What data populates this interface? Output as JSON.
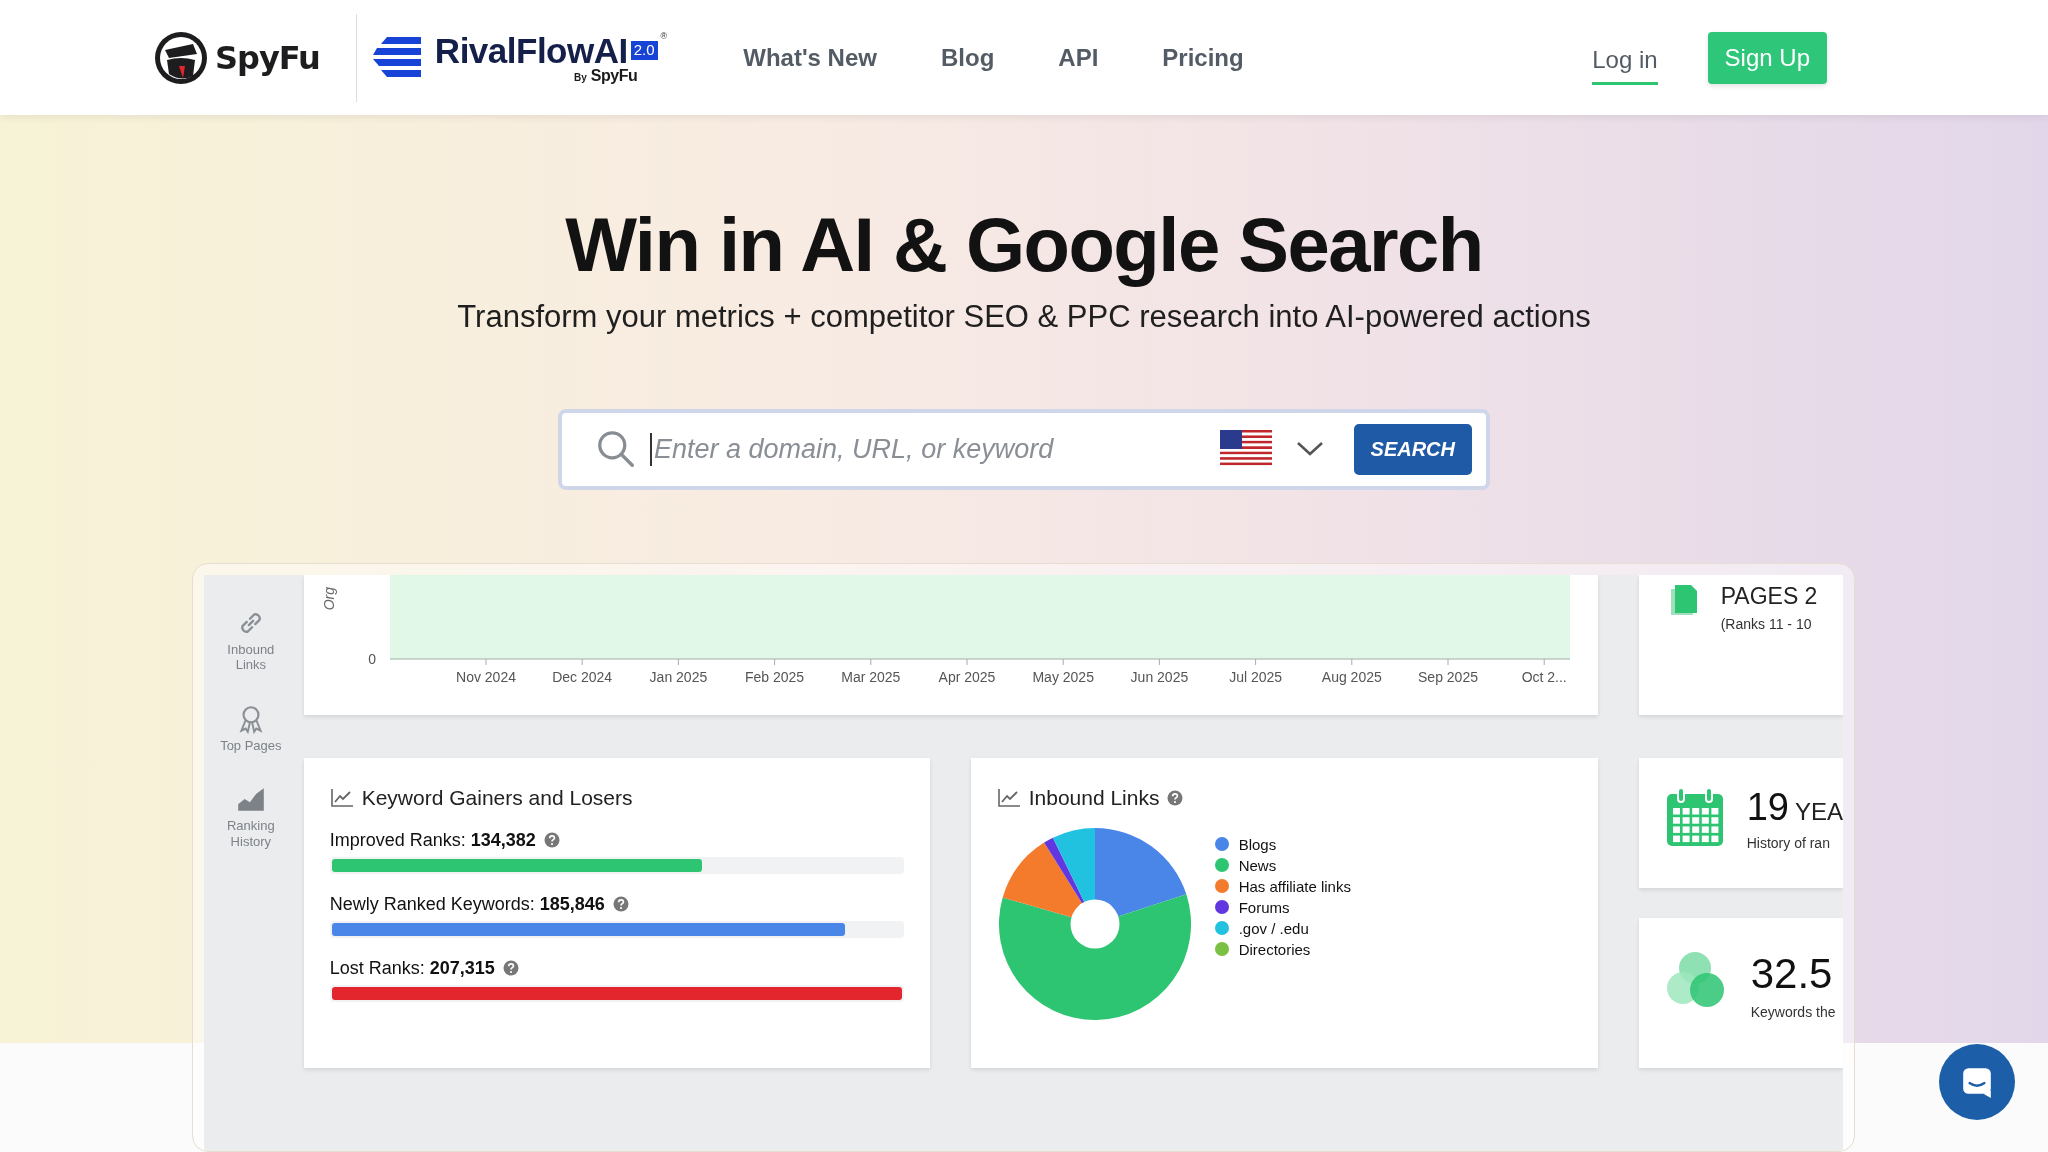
{
  "header": {
    "logo": "SpyFu",
    "product_logo": {
      "name": "RivalFlowAI",
      "version": "2.0",
      "mark": "®",
      "by": "By",
      "by_brand": "SpyFu"
    },
    "nav": [
      "What's New",
      "Blog",
      "API",
      "Pricing"
    ],
    "login": "Log in",
    "signup": "Sign Up"
  },
  "hero": {
    "title": "Win in AI & Google Search",
    "subtitle": "Transform your metrics + competitor SEO & PPC research into AI-powered actions",
    "search": {
      "placeholder": "Enter a domain, URL, or keyword",
      "button": "SEARCH"
    }
  },
  "dashboard": {
    "sidebar": [
      {
        "kind": "link",
        "label": "Inbound Links"
      },
      {
        "kind": "award",
        "label": "Top Pages"
      },
      {
        "kind": "area",
        "label": "Ranking History"
      }
    ],
    "traffic_chart": {
      "y_axis_label": "Org",
      "y_tick": "0",
      "x_labels": [
        "Nov 2024",
        "Dec 2024",
        "Jan 2025",
        "Feb 2025",
        "Mar 2025",
        "Apr 2025",
        "May 2025",
        "Jun 2025",
        "Jul 2025",
        "Aug 2025",
        "Sep 2025",
        "Oct 2..."
      ]
    },
    "gainers": {
      "title": "Keyword Gainers and Losers",
      "rows": [
        {
          "label": "Improved Ranks:",
          "value": "134,382",
          "level": 0.65,
          "color": "#2dc472"
        },
        {
          "label": "Newly Ranked Keywords:",
          "value": "185,846",
          "level": 0.9,
          "color": "#4a86e8"
        },
        {
          "label": "Lost Ranks:",
          "value": "207,315",
          "level": 1.0,
          "color": "#e3262e"
        }
      ]
    },
    "inbound_links": {
      "title": "Inbound Links",
      "legend": [
        {
          "label": "Blogs",
          "color": "#4a86e8"
        },
        {
          "label": "News",
          "color": "#2dc472"
        },
        {
          "label": "Has affiliate links",
          "color": "#f47a2c"
        },
        {
          "label": "Forums",
          "color": "#6236e0"
        },
        {
          "label": ".gov / .edu",
          "color": "#21c1e0"
        },
        {
          "label": "Directories",
          "color": "#79c043"
        }
      ]
    },
    "stat_cards": [
      {
        "kind": "pages",
        "title": "PAGES 2",
        "caption": "(Ranks 11 - 10"
      },
      {
        "kind": "years",
        "value": "19",
        "unit": "YEA",
        "caption": "History of ran"
      },
      {
        "kind": "keywords",
        "value": "32.5",
        "caption": "Keywords the"
      }
    ]
  }
}
